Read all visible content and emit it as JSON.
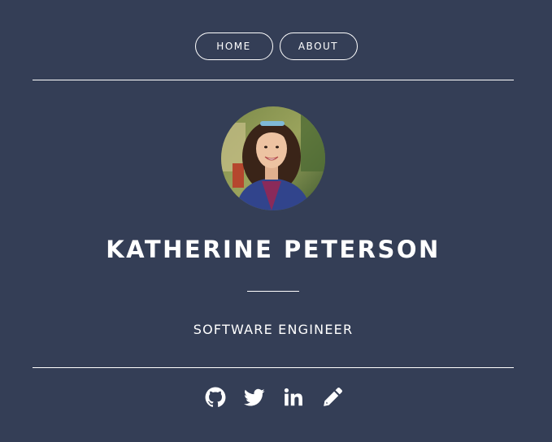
{
  "nav": {
    "home_label": "HOME",
    "about_label": "ABOUT"
  },
  "profile": {
    "name": "KATHERINE PETERSON",
    "role": "SOFTWARE ENGINEER",
    "avatar_icon": "profile-photo"
  },
  "social": {
    "links": [
      {
        "icon": "github-icon"
      },
      {
        "icon": "twitter-icon"
      },
      {
        "icon": "linkedin-icon"
      },
      {
        "icon": "pencil-icon"
      }
    ]
  },
  "colors": {
    "background": "#343e56",
    "foreground": "#ffffff"
  }
}
